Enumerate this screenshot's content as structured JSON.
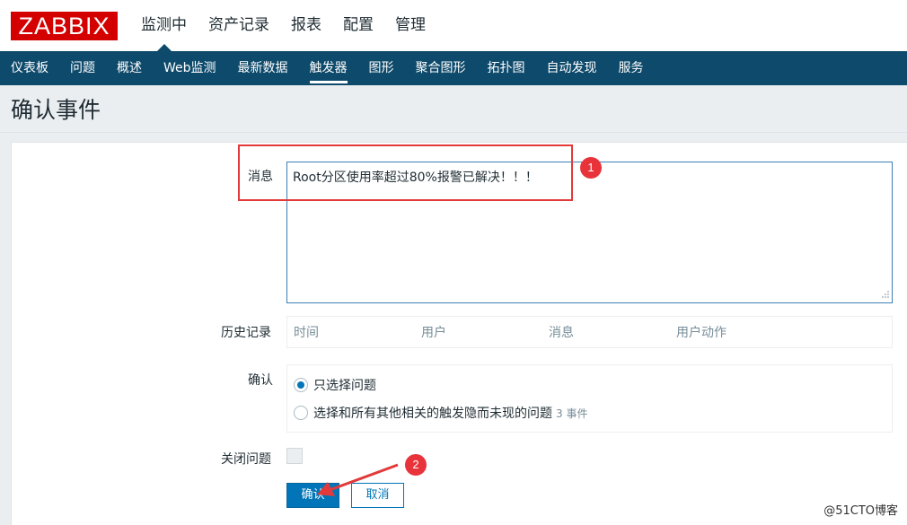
{
  "brand": {
    "logo_text": "ZABBIX"
  },
  "main_menu": [
    {
      "label": "监测中",
      "active": true
    },
    {
      "label": "资产记录"
    },
    {
      "label": "报表"
    },
    {
      "label": "配置"
    },
    {
      "label": "管理"
    }
  ],
  "sub_nav": [
    {
      "label": "仪表板"
    },
    {
      "label": "问题"
    },
    {
      "label": "概述"
    },
    {
      "label": "Web监测"
    },
    {
      "label": "最新数据"
    },
    {
      "label": "触发器",
      "active": true
    },
    {
      "label": "图形"
    },
    {
      "label": "聚合图形"
    },
    {
      "label": "拓扑图"
    },
    {
      "label": "自动发现"
    },
    {
      "label": "服务"
    }
  ],
  "page": {
    "title": "确认事件"
  },
  "form": {
    "message_label": "消息",
    "message_value": "Root分区使用率超过80%报警已解决！！！",
    "history_label": "历史记录",
    "history_columns": [
      "时间",
      "用户",
      "消息",
      "用户动作"
    ],
    "acknowledge_label": "确认",
    "option_selected_only": "只选择问题",
    "option_all_related": "选择和所有其他相关的触发隐而未现的问题",
    "related_events_count": "3 事件",
    "close_problem_label": "关闭问题",
    "submit_label": "确认",
    "cancel_label": "取消"
  },
  "annotations": {
    "badge_1": "1",
    "badge_2": "2"
  },
  "watermark": "@51CTO博客",
  "colors": {
    "header_bg": "#0e4a6b",
    "logo_bg": "#d40000",
    "primary": "#0275b8",
    "annotation_red": "#e8333a"
  }
}
